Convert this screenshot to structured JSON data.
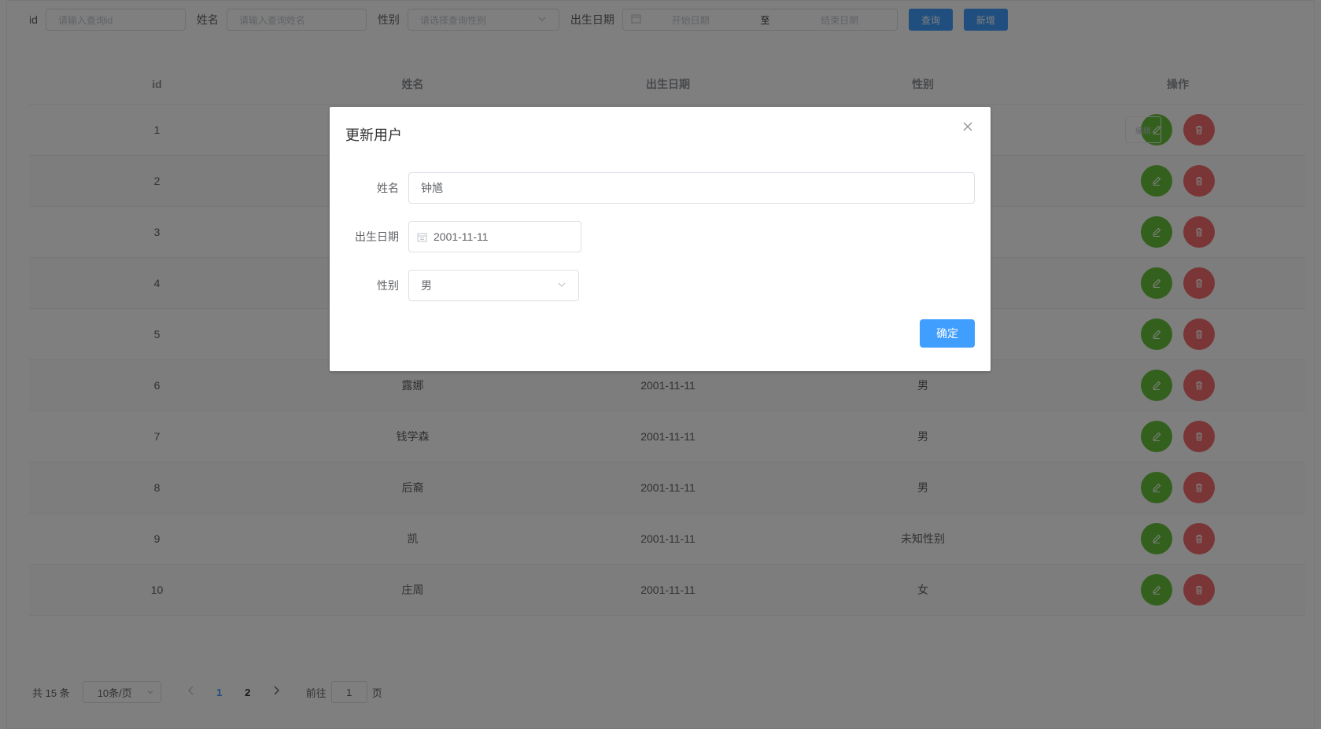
{
  "search": {
    "id_label": "id",
    "id_placeholder": "请输入查询id",
    "name_label": "姓名",
    "name_placeholder": "请输入查询姓名",
    "sex_label": "性别",
    "sex_placeholder": "请选择查询性别",
    "birth_label": "出生日期",
    "start_placeholder": "开始日期",
    "range_separator": "至",
    "end_placeholder": "结束日期",
    "query_button": "查询",
    "add_button": "新增"
  },
  "table": {
    "headers": [
      "id",
      "姓名",
      "出生日期",
      "性别",
      "操作"
    ],
    "rows": [
      {
        "id": "1",
        "name": "",
        "birth": "",
        "sex": ""
      },
      {
        "id": "2",
        "name": "",
        "birth": "",
        "sex": ""
      },
      {
        "id": "3",
        "name": "",
        "birth": "",
        "sex": ""
      },
      {
        "id": "4",
        "name": "",
        "birth": "",
        "sex": ""
      },
      {
        "id": "5",
        "name": "",
        "birth": "",
        "sex": ""
      },
      {
        "id": "6",
        "name": "露娜",
        "birth": "2001-11-11",
        "sex": "男"
      },
      {
        "id": "7",
        "name": "钱学森",
        "birth": "2001-11-11",
        "sex": "男"
      },
      {
        "id": "8",
        "name": "后裔",
        "birth": "2001-11-11",
        "sex": "男"
      },
      {
        "id": "9",
        "name": "凯",
        "birth": "2001-11-11",
        "sex": "未知性别"
      },
      {
        "id": "10",
        "name": "庄周",
        "birth": "2001-11-11",
        "sex": "女"
      }
    ],
    "row1_tooltip": "编辑"
  },
  "pagination": {
    "total": "共 15 条",
    "page_size": "10条/页",
    "pages": [
      "1",
      "2"
    ],
    "current_page": "1",
    "goto_prefix": "前往",
    "goto_value": "1",
    "goto_suffix": "页"
  },
  "dialog": {
    "title": "更新用户",
    "name_label": "姓名",
    "name_value": "钟馗",
    "birth_label": "出生日期",
    "birth_value": "2001-11-11",
    "sex_label": "性别",
    "sex_value": "男",
    "confirm_button": "确定"
  },
  "colors": {
    "primary": "#409eff",
    "success": "#67c23a",
    "danger": "#f56c6c"
  }
}
